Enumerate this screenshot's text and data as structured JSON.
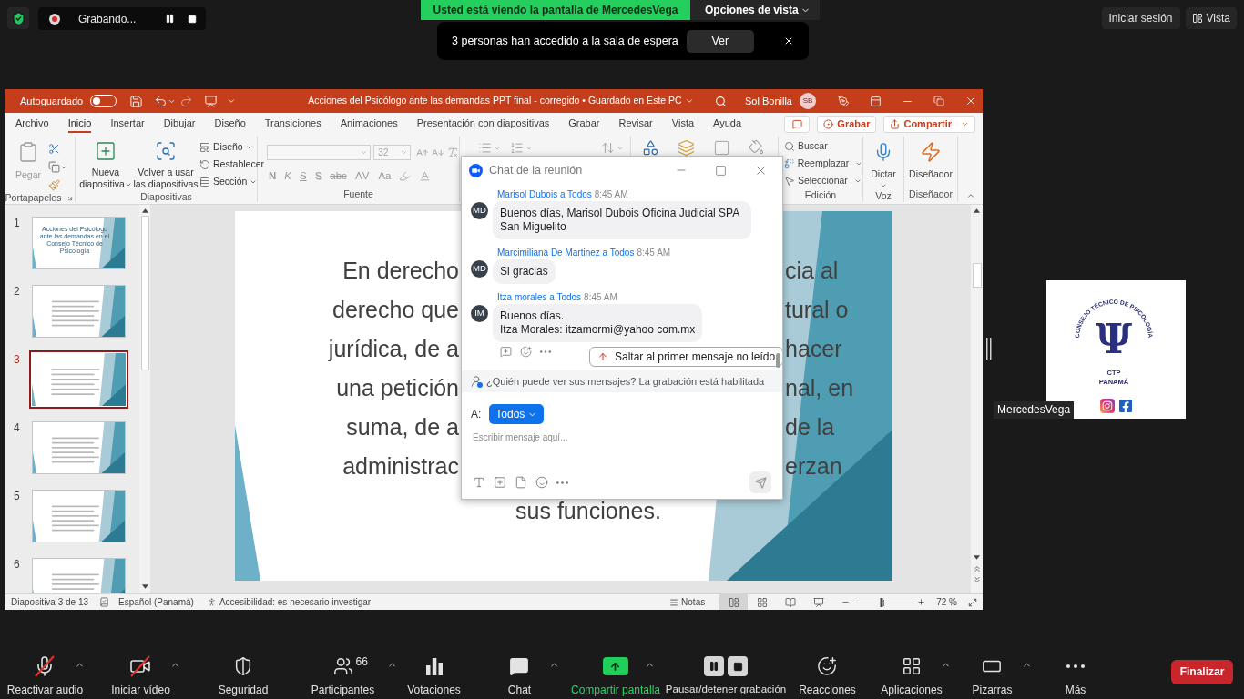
{
  "top_bar": {
    "recording": {
      "label": "Grabando..."
    },
    "share_banner": {
      "text": "Usted está viendo la pantalla de MercedesVega",
      "options": "Opciones de vista"
    },
    "notification": {
      "text": "3 personas han accedido a la sala de espera",
      "button": "Ver"
    },
    "sign_in": "Iniciar sesión",
    "view": "Vista"
  },
  "powerpoint": {
    "title_bar": {
      "autosave": {
        "label": "Autoguardado",
        "on": false
      },
      "title": "Acciones del Psicólogo ante las demandas PPT final - corregido • Guardado en Este PC",
      "user": {
        "name": "Sol Bonilla",
        "initials": "SB"
      }
    },
    "tabs": [
      {
        "label": "Archivo",
        "selected": false
      },
      {
        "label": "Inicio",
        "selected": true
      },
      {
        "label": "Insertar",
        "selected": false
      },
      {
        "label": "Dibujar",
        "selected": false
      },
      {
        "label": "Diseño",
        "selected": false
      },
      {
        "label": "Transiciones",
        "selected": false
      },
      {
        "label": "Animaciones",
        "selected": false
      },
      {
        "label": "Presentación con diapositivas",
        "selected": false
      },
      {
        "label": "Grabar",
        "selected": false
      },
      {
        "label": "Revisar",
        "selected": false
      },
      {
        "label": "Vista",
        "selected": false
      },
      {
        "label": "Ayuda",
        "selected": false
      }
    ],
    "tab_bar_buttons": {
      "record": "Grabar",
      "share": "Compartir"
    },
    "ribbon": [
      {
        "kind": "clipboard",
        "label": "Portapapeles",
        "paste": "Pegar"
      },
      {
        "kind": "slides",
        "label": "Diapositivas",
        "new_slide": {
          "lines": [
            "Nueva",
            "diapositiva"
          ],
          "menu": true
        },
        "reuse": {
          "lines": [
            "Volver a usar",
            "las diapositivas"
          ]
        },
        "items": [
          {
            "kind": "layout",
            "label": "Diseño",
            "menu": true
          },
          {
            "kind": "reset",
            "label": "Restablecer",
            "menu": false
          },
          {
            "kind": "section",
            "label": "Sección",
            "menu": true
          }
        ]
      },
      {
        "kind": "font",
        "label": "Fuente",
        "size": "32",
        "styles": [
          {
            "kind": "bold",
            "label": "N"
          },
          {
            "kind": "italic",
            "label": "K"
          },
          {
            "kind": "underline",
            "label": "S"
          },
          {
            "kind": "shadow",
            "label": "S"
          },
          {
            "kind": "strike",
            "label": "abc"
          },
          {
            "kind": "spacing",
            "label": "AV"
          },
          {
            "kind": "case",
            "label": "Aa"
          }
        ]
      },
      {
        "kind": "paragraph"
      },
      {
        "kind": "drawing"
      },
      {
        "kind": "editing",
        "label": "Edición",
        "items": [
          {
            "kind": "find",
            "label": "Buscar",
            "menu": false
          },
          {
            "kind": "replace",
            "label": "Reemplazar",
            "menu": true
          },
          {
            "kind": "select",
            "label": "Seleccionar",
            "menu": true
          }
        ]
      },
      {
        "kind": "voice",
        "label": "Voz",
        "button": "Dictar",
        "menu": true
      },
      {
        "kind": "designer",
        "label": "Diseñador",
        "button": "Diseñador"
      }
    ],
    "slides": [
      {
        "number": "1",
        "selected": false,
        "title": "Acciones del Psicólogo ante las demandas en el Consejo Técnico de Psicología"
      },
      {
        "number": "2",
        "selected": false
      },
      {
        "number": "3",
        "selected": true
      },
      {
        "number": "4",
        "selected": false
      },
      {
        "number": "5",
        "selected": false
      },
      {
        "number": "6",
        "selected": false
      }
    ],
    "current_slide": {
      "lines": [
        {
          "kind": "split",
          "left": "En derecho",
          "right": "cia al"
        },
        {
          "kind": "split",
          "left": "derecho que",
          "right": "tural o"
        },
        {
          "kind": "split",
          "left": "jurídica, de a",
          "right": "hacer"
        },
        {
          "kind": "split",
          "left": "una petición",
          "right": "nal, en"
        },
        {
          "kind": "split",
          "left": "suma, de a",
          "right": "de la"
        },
        {
          "kind": "split",
          "left": "administrac",
          "right": "erzan"
        },
        {
          "kind": "whole",
          "text": "sus funciones."
        }
      ]
    },
    "status_bar": {
      "position": "Diapositiva 3 de 13",
      "language": "Español (Panamá)",
      "accessibility": "Accesibilidad: es necesario investigar",
      "notes": "Notas",
      "views": [
        {
          "kind": "normal",
          "selected": true
        },
        {
          "kind": "sorter",
          "selected": false
        },
        {
          "kind": "reading",
          "selected": false
        },
        {
          "kind": "slideshow",
          "selected": false
        }
      ],
      "zoom": {
        "level": 0.47,
        "reading": "72 %"
      }
    }
  },
  "chat": {
    "title": "Chat de la reunión",
    "messages": [
      {
        "header": "Marisol Dubois a Todos",
        "time": "8:45 AM",
        "initials": "MD",
        "text": "Buenos días, Marisol Dubois Oficina Judicial SPA San Miguelito",
        "hovered": false
      },
      {
        "header": "Marcimiliana De Martinez a Todos",
        "time": "8:45 AM",
        "initials": "MD",
        "text": "Si gracias",
        "hovered": false
      },
      {
        "header": "Itza morales a Todos",
        "time": "8:45 AM",
        "initials": "IM",
        "text": "Buenos días.\nItza Morales: itzamormi@yahoo com.mx",
        "hovered": true
      }
    ],
    "jump_button": "Saltar al primer mensaje no leído",
    "privacy_note": "¿Quién puede ver sus mensajes? La grabación está habilitada",
    "recipient_label": "A:",
    "recipient": "Todos",
    "placeholder": "Escribir mensaje aquí..."
  },
  "video_tile": {
    "name": "MercedesVega",
    "logo": {
      "arc_text": "CONSEJO TÉCNICO DE PSICOLOGÍA",
      "symbol": "Ψ",
      "lines": [
        "CTP",
        "PANAMÁ"
      ]
    }
  },
  "toolbar": {
    "items": [
      {
        "kind": "mic",
        "label": "Reactivar audio",
        "muted": true,
        "menu": true
      },
      {
        "kind": "video",
        "label": "Iniciar vídeo",
        "muted": true,
        "menu": true
      },
      {
        "kind": "security",
        "label": "Seguridad",
        "menu": false
      },
      {
        "kind": "participants",
        "label": "Participantes",
        "count": "66",
        "menu": true
      },
      {
        "kind": "polls",
        "label": "Votaciones",
        "menu": false
      },
      {
        "kind": "chat",
        "label": "Chat",
        "menu": true
      },
      {
        "kind": "share",
        "label": "Compartir pantalla",
        "menu": true
      },
      {
        "kind": "recording",
        "label": "Pausar/detener grabación",
        "menu": false
      },
      {
        "kind": "reactions",
        "label": "Reacciones",
        "menu": false
      },
      {
        "kind": "apps",
        "label": "Aplicaciones",
        "menu": true
      },
      {
        "kind": "whiteboards",
        "label": "Pizarras",
        "menu": true
      },
      {
        "kind": "more",
        "label": "Más",
        "menu": false
      }
    ],
    "end_button": "Finalizar"
  }
}
